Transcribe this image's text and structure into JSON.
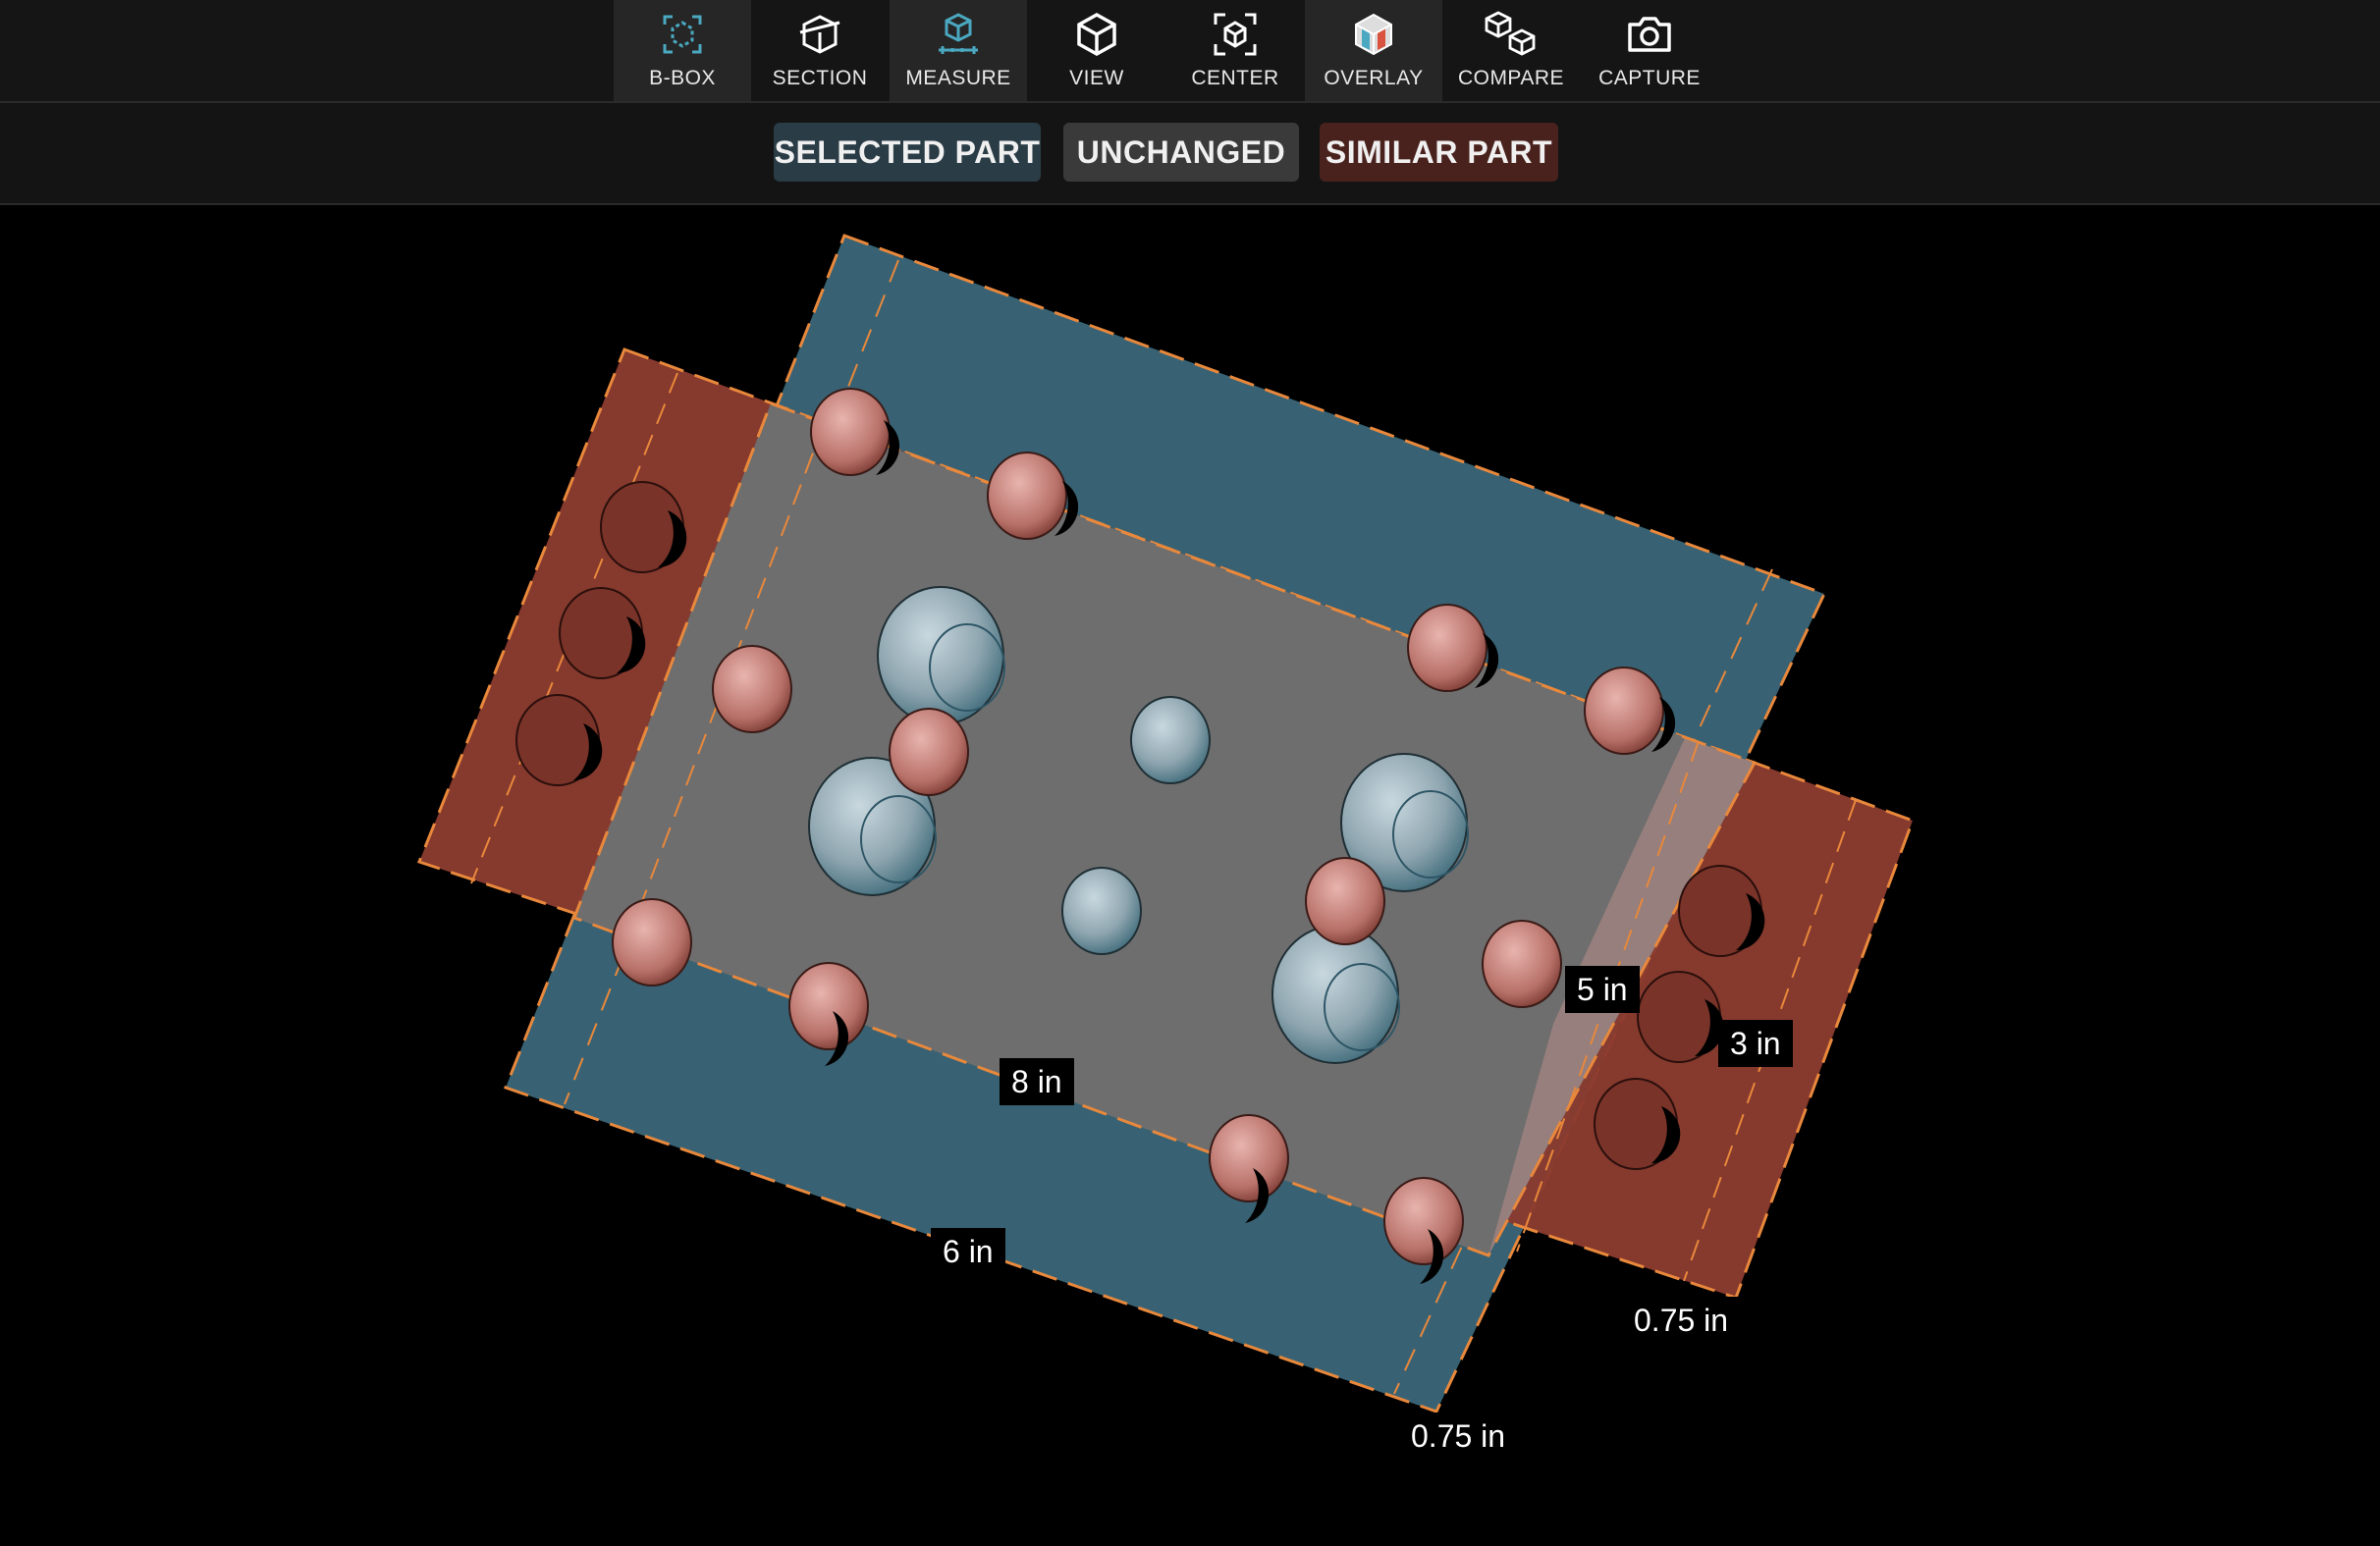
{
  "toolbar": {
    "items": [
      {
        "label": "B-BOX",
        "icon": "bbox-icon"
      },
      {
        "label": "SECTION",
        "icon": "section-icon"
      },
      {
        "label": "MEASURE",
        "icon": "measure-icon"
      },
      {
        "label": "VIEW",
        "icon": "view-cube-icon"
      },
      {
        "label": "CENTER",
        "icon": "center-icon"
      },
      {
        "label": "OVERLAY",
        "icon": "overlay-icon"
      },
      {
        "label": "COMPARE",
        "icon": "compare-icon"
      },
      {
        "label": "CAPTURE",
        "icon": "camera-icon"
      }
    ],
    "active": [
      "B-BOX",
      "MEASURE",
      "OVERLAY"
    ]
  },
  "legend": {
    "selected": {
      "label": "SELECTED PART",
      "color": "#2a3c46"
    },
    "unchanged": {
      "label": "UNCHANGED",
      "color": "#3a3a3a"
    },
    "similar": {
      "label": "SIMILAR PART",
      "color": "#4a221d"
    }
  },
  "colors": {
    "selected_part": "#3a6577",
    "similar_part": "#8a3b2e",
    "unchanged_overlap": "#6e6e6e",
    "accent_orange": "#e8883c",
    "accent_teal": "#4aa8c0"
  },
  "dimensions": {
    "d1": "5 in",
    "d2": "3 in",
    "d3": "8 in",
    "d4": "6 in",
    "d5": "0.75 in",
    "d6": "0.75 in"
  }
}
